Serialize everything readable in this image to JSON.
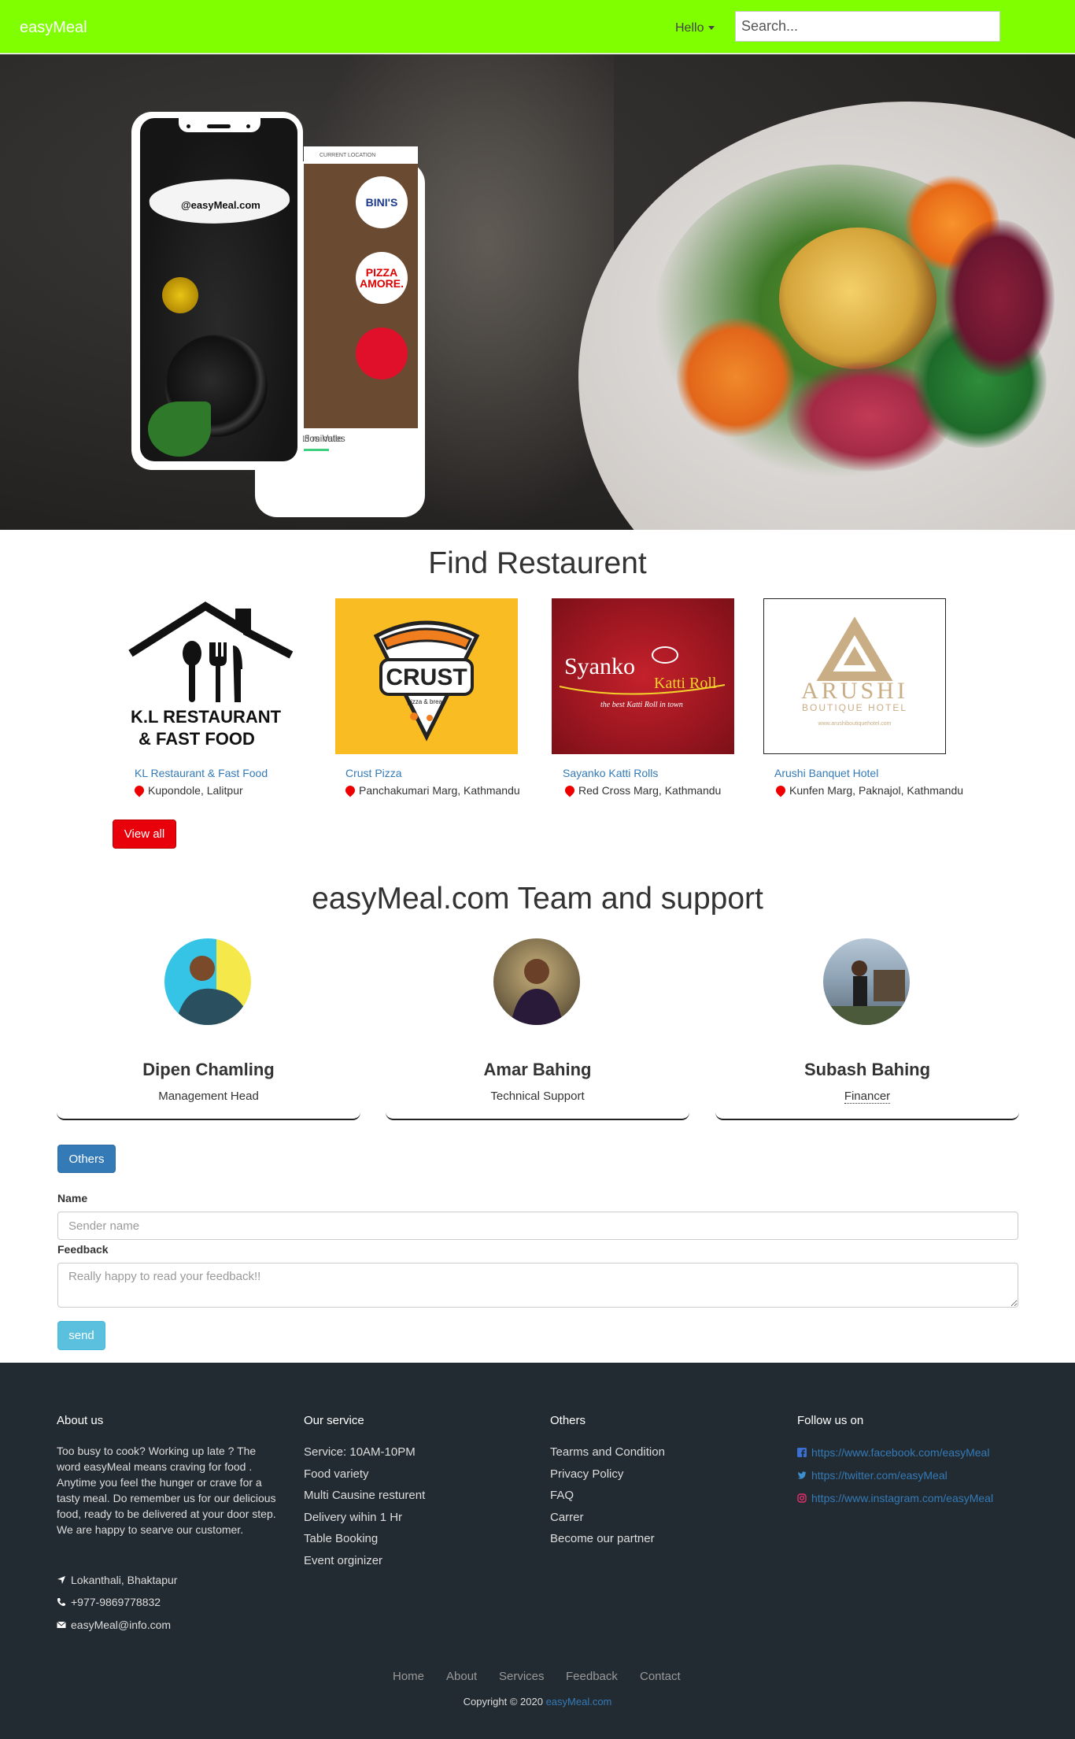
{
  "navbar": {
    "brand": "easyMeal",
    "hello_label": "Hello",
    "search_placeholder": "Search...",
    "bg_color": "#7fff00"
  },
  "hero": {
    "phone_handle": "@easyMeal.com",
    "back_screen_header": "CURRENT LOCATION",
    "back_screen_user": "arlos Valle",
    "back_screen_minutes": "23 minutes",
    "logos": [
      "BINI'S",
      "PIZZA AMORE."
    ]
  },
  "restaurants": {
    "title": "Find Restaurent",
    "items": [
      {
        "name": "KL Restaurant & Fast Food",
        "location": "Kupondole, Lalitpur",
        "logo_text": "K.L RESTAURANT & FAST FOOD"
      },
      {
        "name": "Crust Pizza",
        "location": "Panchakumari Marg, Kathmandu",
        "logo_text": "CRUST",
        "logo_sub": "pizza & bread"
      },
      {
        "name": "Sayanko Katti Rolls",
        "location": "Red Cross Marg, Kathmandu",
        "logo_text": "Syanko",
        "logo_sub": "Katti Roll",
        "logo_tag": "the best Katti Roll in town"
      },
      {
        "name": "Arushi Banquet Hotel",
        "location": "Kunfen Marg, Paknajol, Kathmandu",
        "logo_text": "ARUSHI",
        "logo_sub": "BOUTIQUE HOTEL",
        "logo_url": "www.arushiboutiquehotel.com"
      }
    ],
    "view_all": "View all"
  },
  "team": {
    "title": "easyMeal.com Team and support",
    "members": [
      {
        "name": "Dipen Chamling",
        "role": "Management Head"
      },
      {
        "name": "Amar Bahing",
        "role": "Technical Support"
      },
      {
        "name": "Subash Bahing",
        "role": "Financer"
      }
    ]
  },
  "feedback": {
    "others_button": "Others",
    "name_label": "Name",
    "name_placeholder": "Sender name",
    "feedback_label": "Feedback",
    "feedback_placeholder": "Really happy to read your feedback!!",
    "send_button": "send"
  },
  "footer": {
    "about": {
      "title": "About us",
      "text": "Too busy to cook? Working up late ? The word easyMeal means craving for food . Anytime you feel the hunger or crave for a tasty meal. Do remember us for our delicious food, ready to be delivered at your door step. We are happy to searve our customer.",
      "address": "Lokanthali, Bhaktapur",
      "phone": "+977-9869778832",
      "email": "easyMeal@info.com"
    },
    "service": {
      "title": "Our service",
      "items": [
        "Service: 10AM-10PM",
        "Food variety",
        "Multi Causine resturent",
        "Delivery wihin 1 Hr",
        "Table Booking",
        "Event orginizer"
      ]
    },
    "others": {
      "title": "Others",
      "items": [
        "Tearms and Condition",
        "Privacy Policy",
        "FAQ",
        "Carrer",
        "Become our partner"
      ]
    },
    "follow": {
      "title": "Follow us on",
      "links": [
        "https://www.facebook.com/easyMeal",
        "https://twitter.com/easyMeal",
        "https://www.instagram.com/easyMeal"
      ]
    },
    "bottom_links": [
      "Home",
      "About",
      "Services",
      "Feedback",
      "Contact"
    ],
    "copyright": "Copyright © 2020",
    "copyright_link": "easyMeal.com",
    "bg_color": "#232b32"
  }
}
